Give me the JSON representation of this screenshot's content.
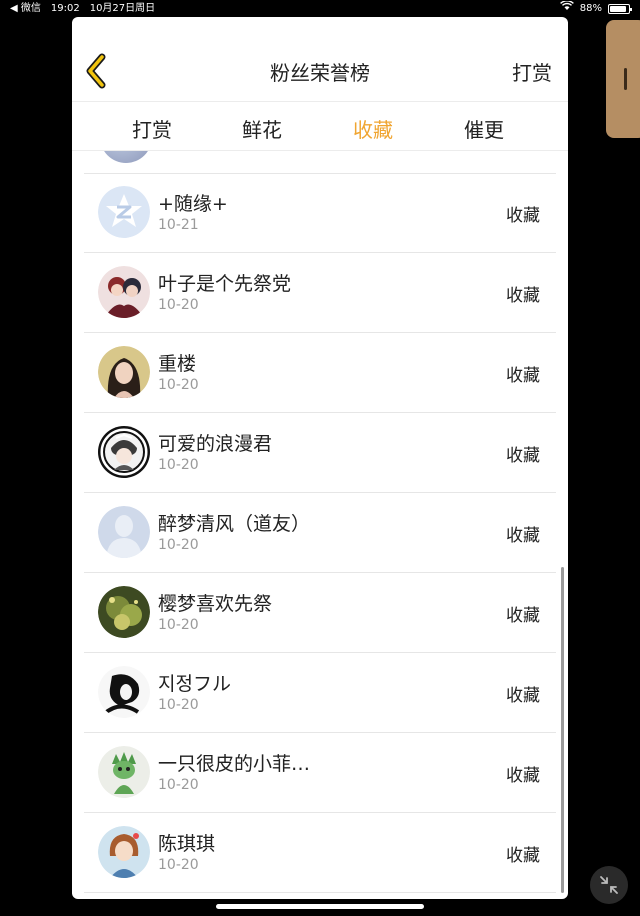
{
  "status_bar": {
    "back_app": "◀ 微信",
    "time": "19:02",
    "date": "10月27日周日",
    "battery": "88%"
  },
  "header": {
    "title": "粉丝荣誉榜",
    "action": "打赏"
  },
  "tabs": [
    {
      "label": "打赏",
      "active": false
    },
    {
      "label": "鲜花",
      "active": false
    },
    {
      "label": "收藏",
      "active": true
    },
    {
      "label": "催更",
      "active": false
    }
  ],
  "rows": [
    {
      "name": "+随缘+",
      "date": "10-21",
      "action": "收藏",
      "avatar": "qq-logo-avatar"
    },
    {
      "name": "叶子是个先祭党",
      "date": "10-20",
      "action": "收藏",
      "avatar": "anime-pair-avatar"
    },
    {
      "name": "重楼",
      "date": "10-20",
      "action": "收藏",
      "avatar": "portrait-avatar"
    },
    {
      "name": "可爱的浪漫君",
      "date": "10-20",
      "action": "收藏",
      "avatar": "maid-avatar"
    },
    {
      "name": "醉梦清风（道友）",
      "date": "10-20",
      "action": "收藏",
      "avatar": "default-user-avatar"
    },
    {
      "name": "樱梦喜欢先祭",
      "date": "10-20",
      "action": "收藏",
      "avatar": "forest-avatar"
    },
    {
      "name": "지정フル",
      "date": "10-20",
      "action": "收藏",
      "avatar": "sketch-avatar"
    },
    {
      "name": "一只很皮的小菲…",
      "date": "10-20",
      "action": "收藏",
      "avatar": "green-dragon-avatar"
    },
    {
      "name": "陈琪琪",
      "date": "10-20",
      "action": "收藏",
      "avatar": "girl-avatar"
    }
  ],
  "colors": {
    "active_tab": "#f0a531",
    "back_arrow": "#f1c40f"
  }
}
